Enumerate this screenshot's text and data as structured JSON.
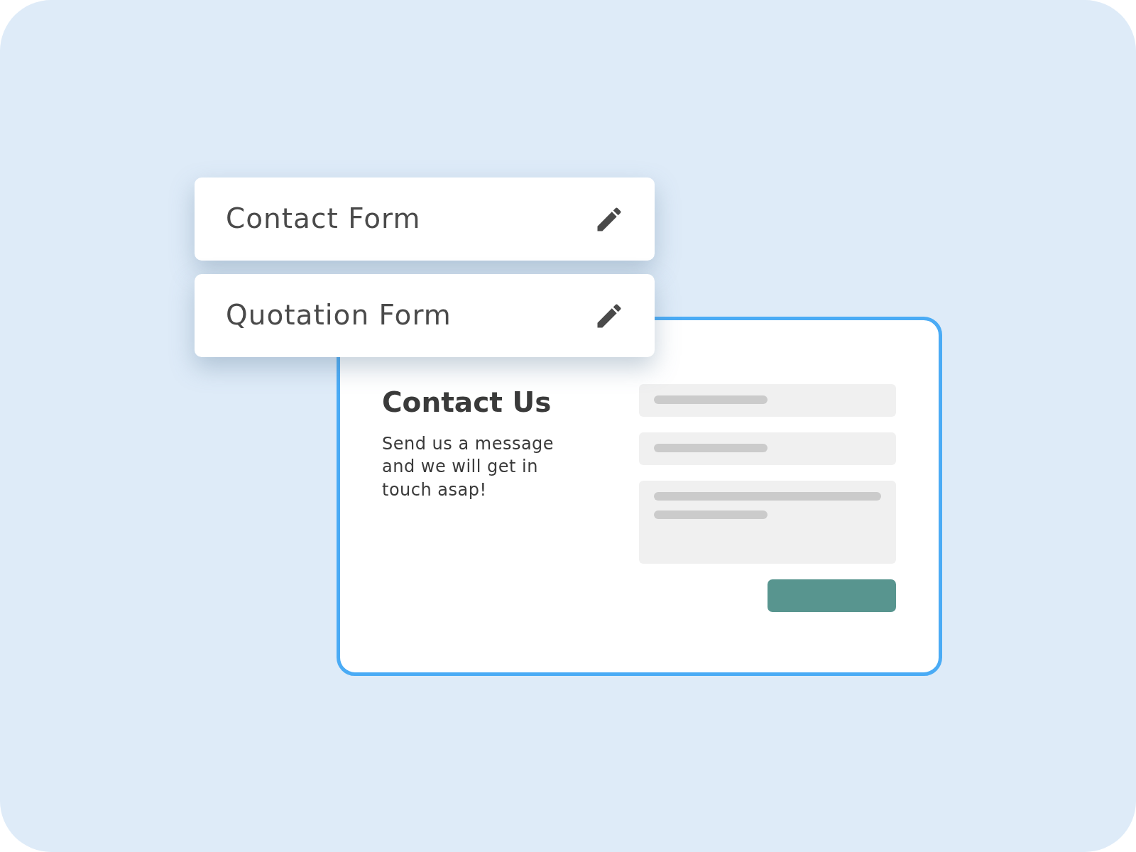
{
  "form_list": [
    {
      "label": "Contact Form"
    },
    {
      "label": "Quotation Form"
    }
  ],
  "contact_card": {
    "title": "Contact Us",
    "description": "Send us a message and we will get in touch asap!",
    "fields": [
      {
        "kind": "input"
      },
      {
        "kind": "input"
      },
      {
        "kind": "textarea"
      }
    ]
  }
}
